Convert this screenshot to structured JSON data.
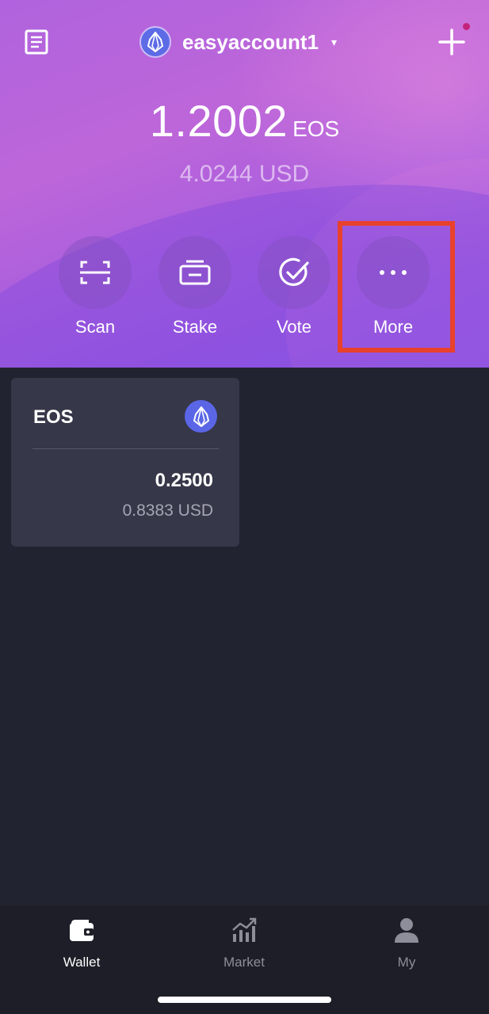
{
  "header": {
    "account_name": "easyaccount1",
    "caret": "▾",
    "balance_amount": "1.2002",
    "balance_unit": "EOS",
    "balance_usd": "4.0244 USD"
  },
  "actions": [
    {
      "label": "Scan",
      "icon": "scan-icon"
    },
    {
      "label": "Stake",
      "icon": "stake-icon"
    },
    {
      "label": "Vote",
      "icon": "vote-icon"
    },
    {
      "label": "More",
      "icon": "more-icon"
    }
  ],
  "highlight": {
    "target": "More",
    "color": "#e8412c"
  },
  "assets": [
    {
      "symbol": "EOS",
      "amount": "0.2500",
      "usd": "0.8383 USD",
      "icon": "eos-logo-icon"
    }
  ],
  "tabbar": {
    "tabs": [
      {
        "label": "Wallet",
        "icon": "wallet-icon",
        "active": true
      },
      {
        "label": "Market",
        "icon": "market-chart-icon",
        "active": false
      },
      {
        "label": "My",
        "icon": "user-icon",
        "active": false
      }
    ]
  },
  "colors": {
    "header_gradient_start": "#b063de",
    "header_gradient_end": "#8d57e6",
    "body_background": "#222330",
    "card_background": "#363748",
    "notification_dot": "#c4237a",
    "highlight_border": "#e8412c"
  }
}
